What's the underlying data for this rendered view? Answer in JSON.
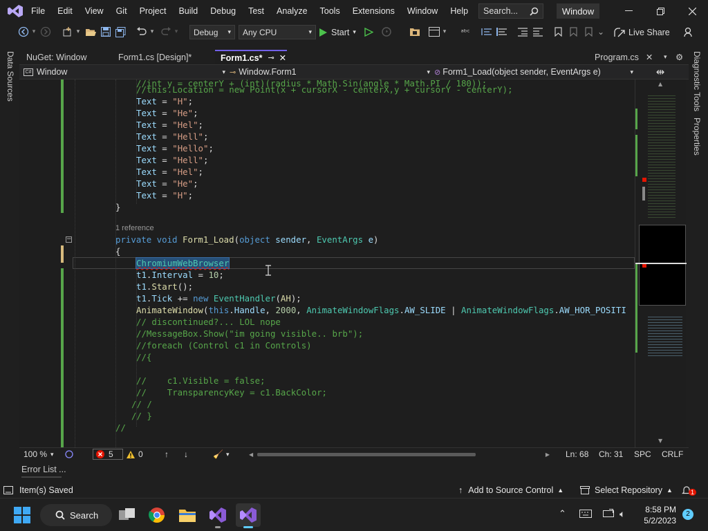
{
  "menubar": {
    "items": [
      "File",
      "Edit",
      "View",
      "Git",
      "Project",
      "Build",
      "Debug",
      "Test",
      "Analyze",
      "Tools",
      "Extensions",
      "Window",
      "Help"
    ],
    "search_placeholder": "Search...",
    "window_title": "Window"
  },
  "toolbar": {
    "config": "Debug",
    "platform": "Any CPU",
    "start_label": "Start",
    "live_share": "Live Share"
  },
  "side_left": {
    "label": "Data Sources"
  },
  "side_right": {
    "labels": [
      "Diagnostic Tools",
      "Properties"
    ]
  },
  "tabs": {
    "items": [
      {
        "label": "NuGet: Window"
      },
      {
        "label": "Form1.cs [Design]*"
      },
      {
        "label": "Form1.cs*",
        "active": true
      },
      {
        "label": "Program.cs"
      }
    ]
  },
  "navbar": {
    "project": "Window",
    "class": "Window.Form1",
    "member": "Form1_Load(object sender, EventArgs e)"
  },
  "editor": {
    "reference_label": "1 reference",
    "lines": [
      "//int y = centerY + (int)(radius * Math.Sin(angle * Math.PI / 180));",
      "//this.Location = new Point(x + cursorX - centerX,y + cursorY - centerY);",
      "Text = \"H\";",
      "Text = \"He\";",
      "Text = \"Hel\";",
      "Text = \"Hell\";",
      "Text = \"Hello\";",
      "Text = \"Hell\";",
      "Text = \"Hel\";",
      "Text = \"He\";",
      "Text = \"H\";",
      "}",
      "private void Form1_Load(object sender, EventArgs e)",
      "{",
      "ChromiumWebBrowser",
      "t1.Interval = 10;",
      "t1.Start();",
      "t1.Tick += new EventHandler(AH);",
      "AnimateWindow(this.Handle, 2000, AnimateWindowFlags.AW_SLIDE | AnimateWindowFlags.AW_HOR_POSITI",
      "// discontinued?... LOL nope",
      "//MessageBox.Show(\"im going visible.. brb\");",
      "//foreach (Control c1 in Controls)",
      "//{",
      "//    c1.Visible = false;",
      "//    TransparencyKey = c1.BackColor;",
      "// /",
      "// }",
      "//"
    ]
  },
  "editor_status": {
    "zoom": "100 %",
    "errors": "5",
    "warnings": "0",
    "line": "Ln: 68",
    "col": "Ch: 31",
    "spacing": "SPC",
    "eol": "CRLF"
  },
  "error_list": {
    "label": "Error List ..."
  },
  "statusbar": {
    "message": "Item(s) Saved",
    "source_control": "Add to Source Control",
    "repository": "Select Repository",
    "notifications": "1"
  },
  "taskbar": {
    "search": "Search",
    "time": "8:58 PM",
    "date": "5/2/2023",
    "notif_count": "2"
  },
  "colors": {
    "accent": "#7160e8",
    "change_bar": "#57a64a",
    "error": "#e51400"
  }
}
